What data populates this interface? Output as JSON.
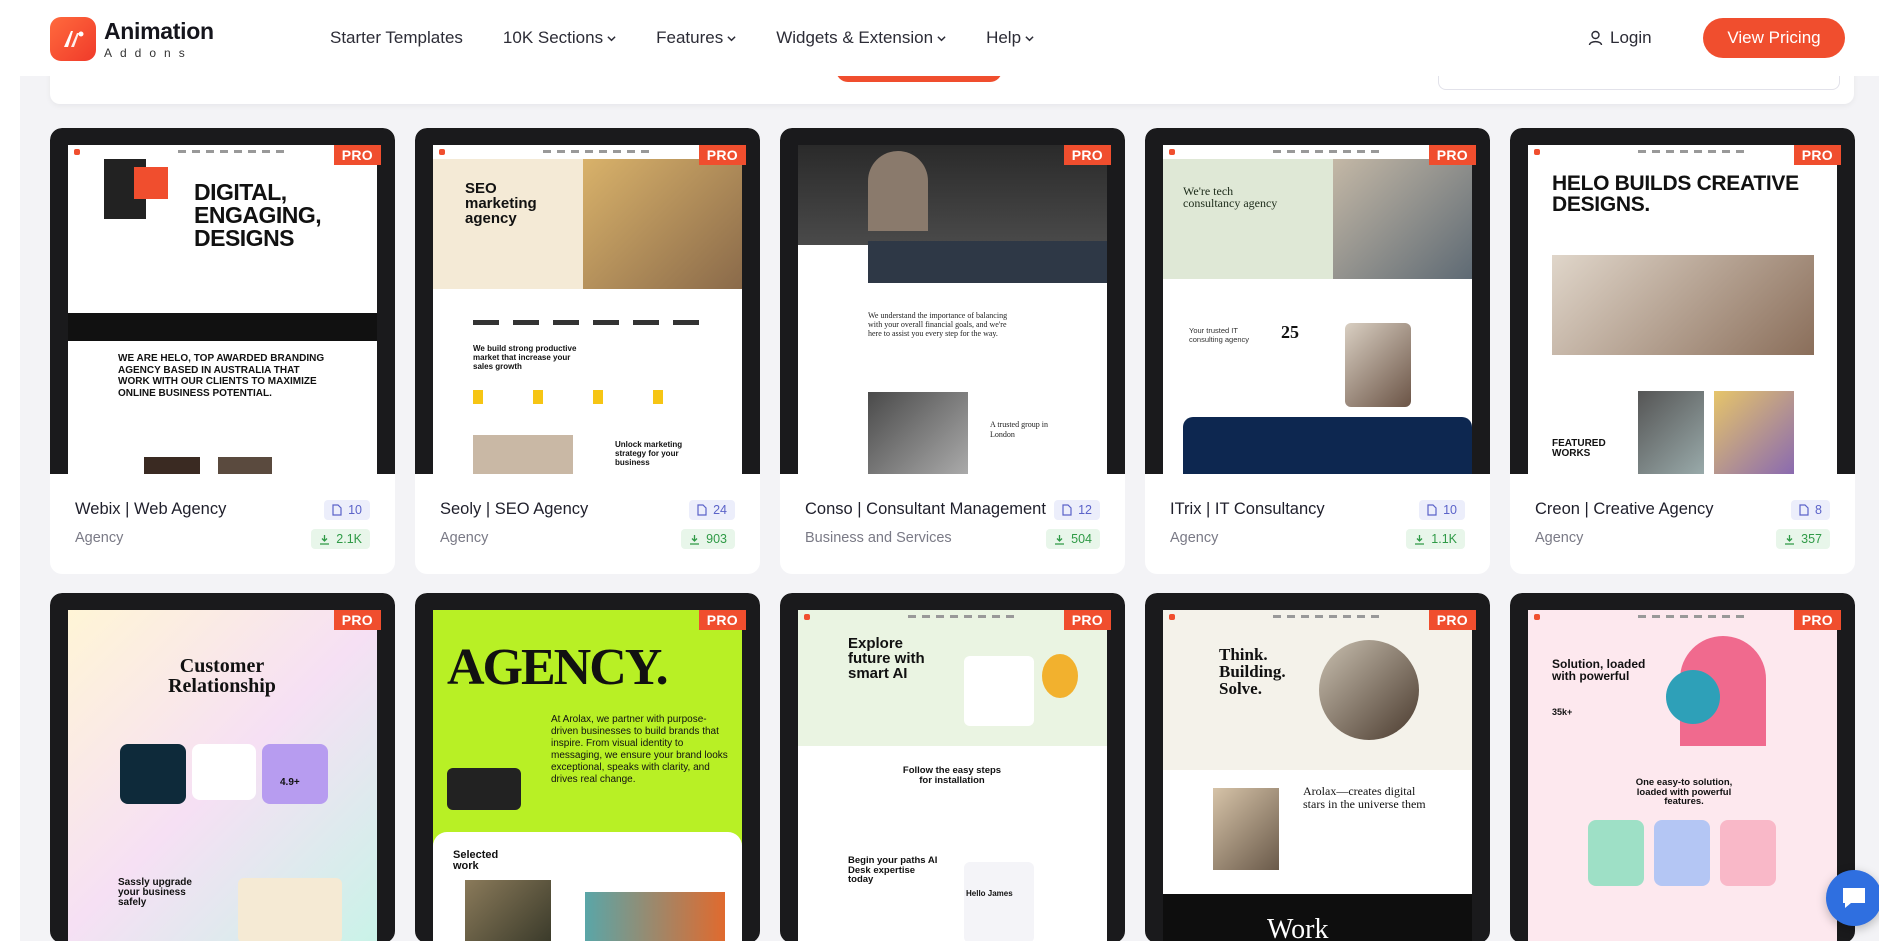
{
  "brand": {
    "title": "Animation",
    "subtitle": "Addons"
  },
  "nav": {
    "items": [
      {
        "label": "Starter Templates",
        "dropdown": false
      },
      {
        "label": "10K Sections",
        "dropdown": true
      },
      {
        "label": "Features",
        "dropdown": true
      },
      {
        "label": "Widgets & Extension",
        "dropdown": true
      },
      {
        "label": "Help",
        "dropdown": true
      }
    ],
    "login": "Login",
    "cta": "View Pricing"
  },
  "badge": "PRO",
  "templates": [
    {
      "title": "Webix | Web Agency",
      "category": "Agency",
      "pages": "10",
      "downloads": "2.1K",
      "thumb": {
        "headline": "DIGITAL, ENGAGING, DESIGNS",
        "body": "WE ARE HELO, TOP AWARDED BRANDING AGENCY BASED IN AUSTRALIA THAT WORK WITH OUR CLIENTS TO MAXIMIZE ONLINE BUSINESS POTENTIAL."
      }
    },
    {
      "title": "Seoly | SEO Agency",
      "category": "Agency",
      "pages": "24",
      "downloads": "903",
      "thumb": {
        "headline": "SEO marketing agency",
        "body": "We build strong productive market that increase your sales growth",
        "footer": "Unlock marketing strategy for your business"
      }
    },
    {
      "title": "Conso | Consultant Management",
      "category": "Business and Services",
      "pages": "12",
      "downloads": "504",
      "thumb": {
        "headline": "We understand the importance of balancing with your overall financial goals, and we're here to assist you every step for the way.",
        "footer": "A trusted group in London"
      }
    },
    {
      "title": "ITrix | IT Consultancy",
      "category": "Agency",
      "pages": "10",
      "downloads": "1.1K",
      "thumb": {
        "headline": "We're tech consultancy agency",
        "stat": "25",
        "body": "Your trusted IT consulting agency"
      }
    },
    {
      "title": "Creon | Creative Agency",
      "category": "Agency",
      "pages": "8",
      "downloads": "357",
      "thumb": {
        "headline": "HELO BUILDS CREATIVE DESIGNS.",
        "footer": "FEATURED WORKS"
      }
    },
    {
      "title": "",
      "category": "",
      "pages": "",
      "downloads": "",
      "thumb": {
        "headline": "Customer Relationship",
        "body": "Sassly upgrade your business safely",
        "stat": "4.9+"
      }
    },
    {
      "title": "",
      "category": "",
      "pages": "",
      "downloads": "",
      "thumb": {
        "headline": "AGENCY.",
        "body": "At Arolax, we partner with purpose-driven businesses to build brands that inspire. From visual identity to messaging, we ensure your brand looks exceptional, speaks with clarity, and drives real change.",
        "footer": "Selected work"
      }
    },
    {
      "title": "",
      "category": "",
      "pages": "",
      "downloads": "",
      "thumb": {
        "headline": "Explore future with smart AI",
        "body": "Follow the easy steps for installation",
        "footer": "Begin your paths AI Desk expertise today",
        "extra": "Hello James"
      }
    },
    {
      "title": "",
      "category": "",
      "pages": "",
      "downloads": "",
      "thumb": {
        "headline": "Think. Building. Solve.",
        "body": "Arolax—creates digital stars in the universe them",
        "footer": "Work"
      }
    },
    {
      "title": "",
      "category": "",
      "pages": "",
      "downloads": "",
      "thumb": {
        "headline": "Solution, loaded with powerful",
        "body": "One easy-to solution, loaded with powerful features.",
        "stat": "35k+"
      }
    }
  ],
  "colors": {
    "accent": "#f04e2e",
    "pages_badge": "#5b63c9",
    "downloads_badge": "#2f9a46",
    "chat": "#2f6fe0"
  },
  "icons": {
    "pages": "document-icon",
    "downloads": "download-icon",
    "login": "user-icon",
    "chat": "chat-icon"
  }
}
